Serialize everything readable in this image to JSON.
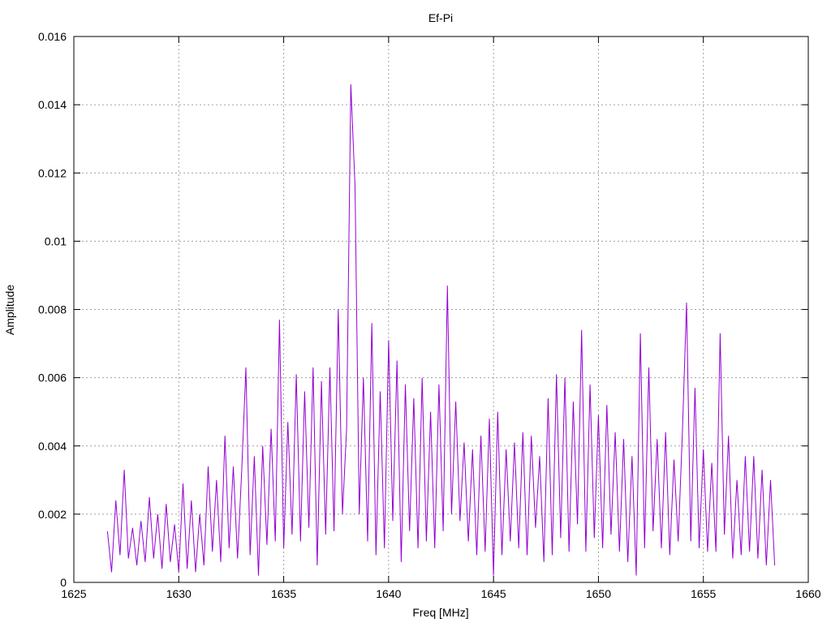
{
  "chart_data": {
    "type": "line",
    "title": "Ef-Pi",
    "xlabel": "Freq [MHz]",
    "ylabel": "Amplitude",
    "xlim": [
      1625,
      1660
    ],
    "ylim": [
      0,
      0.016
    ],
    "xticks": [
      1625,
      1630,
      1635,
      1640,
      1645,
      1650,
      1655,
      1660
    ],
    "xtick_labels": [
      "1625",
      "1630",
      "1635",
      "1640",
      "1645",
      "1650",
      "1655",
      "1660"
    ],
    "yticks": [
      0,
      0.002,
      0.004,
      0.006,
      0.008,
      0.01,
      0.012,
      0.014,
      0.016
    ],
    "ytick_labels": [
      "0",
      "0.002",
      "0.004",
      "0.006",
      "0.008",
      "0.01",
      "0.012",
      "0.014",
      "0.016"
    ],
    "grid": true,
    "series": [
      {
        "name": "Ef-Pi",
        "color": "#9400d3",
        "x_start": 1626.6,
        "x_step": 0.2,
        "values": [
          0.0015,
          0.0003,
          0.0024,
          0.0008,
          0.0033,
          0.0007,
          0.0016,
          0.0005,
          0.0018,
          0.0006,
          0.0025,
          0.0007,
          0.002,
          0.0004,
          0.0023,
          0.0006,
          0.0017,
          0.0003,
          0.0029,
          0.0004,
          0.0024,
          0.0003,
          0.002,
          0.0005,
          0.0034,
          0.0009,
          0.003,
          0.0006,
          0.0043,
          0.001,
          0.0034,
          0.0007,
          0.0033,
          0.0063,
          0.0008,
          0.0037,
          0.0002,
          0.004,
          0.0011,
          0.0045,
          0.0012,
          0.0077,
          0.001,
          0.0047,
          0.0014,
          0.0061,
          0.0012,
          0.0056,
          0.0016,
          0.0063,
          0.0005,
          0.0059,
          0.0014,
          0.0063,
          0.0015,
          0.008,
          0.002,
          0.0045,
          0.0146,
          0.0116,
          0.002,
          0.006,
          0.0012,
          0.0076,
          0.0008,
          0.0056,
          0.001,
          0.0071,
          0.0018,
          0.0065,
          0.0006,
          0.0058,
          0.0015,
          0.0054,
          0.001,
          0.006,
          0.0012,
          0.005,
          0.001,
          0.0058,
          0.0015,
          0.0087,
          0.002,
          0.0053,
          0.0018,
          0.0041,
          0.0012,
          0.0039,
          0.0008,
          0.0043,
          0.0009,
          0.0048,
          0.0002,
          0.005,
          0.0008,
          0.0039,
          0.0012,
          0.0041,
          0.001,
          0.0044,
          0.0008,
          0.0043,
          0.0016,
          0.0037,
          0.0006,
          0.0054,
          0.0008,
          0.0061,
          0.0013,
          0.006,
          0.0009,
          0.0053,
          0.0017,
          0.0074,
          0.0009,
          0.0058,
          0.0013,
          0.0049,
          0.001,
          0.0052,
          0.0014,
          0.0044,
          0.0009,
          0.0042,
          0.0006,
          0.0037,
          0.0002,
          0.0073,
          0.001,
          0.0063,
          0.0015,
          0.0042,
          0.001,
          0.0044,
          0.0008,
          0.0036,
          0.0012,
          0.0044,
          0.0082,
          0.0012,
          0.0057,
          0.001,
          0.0039,
          0.0009,
          0.0035,
          0.0009,
          0.0073,
          0.0014,
          0.0043,
          0.0007,
          0.003,
          0.0008,
          0.0037,
          0.0009,
          0.0037,
          0.0007,
          0.0033,
          0.0005,
          0.003,
          0.0005
        ]
      }
    ]
  }
}
